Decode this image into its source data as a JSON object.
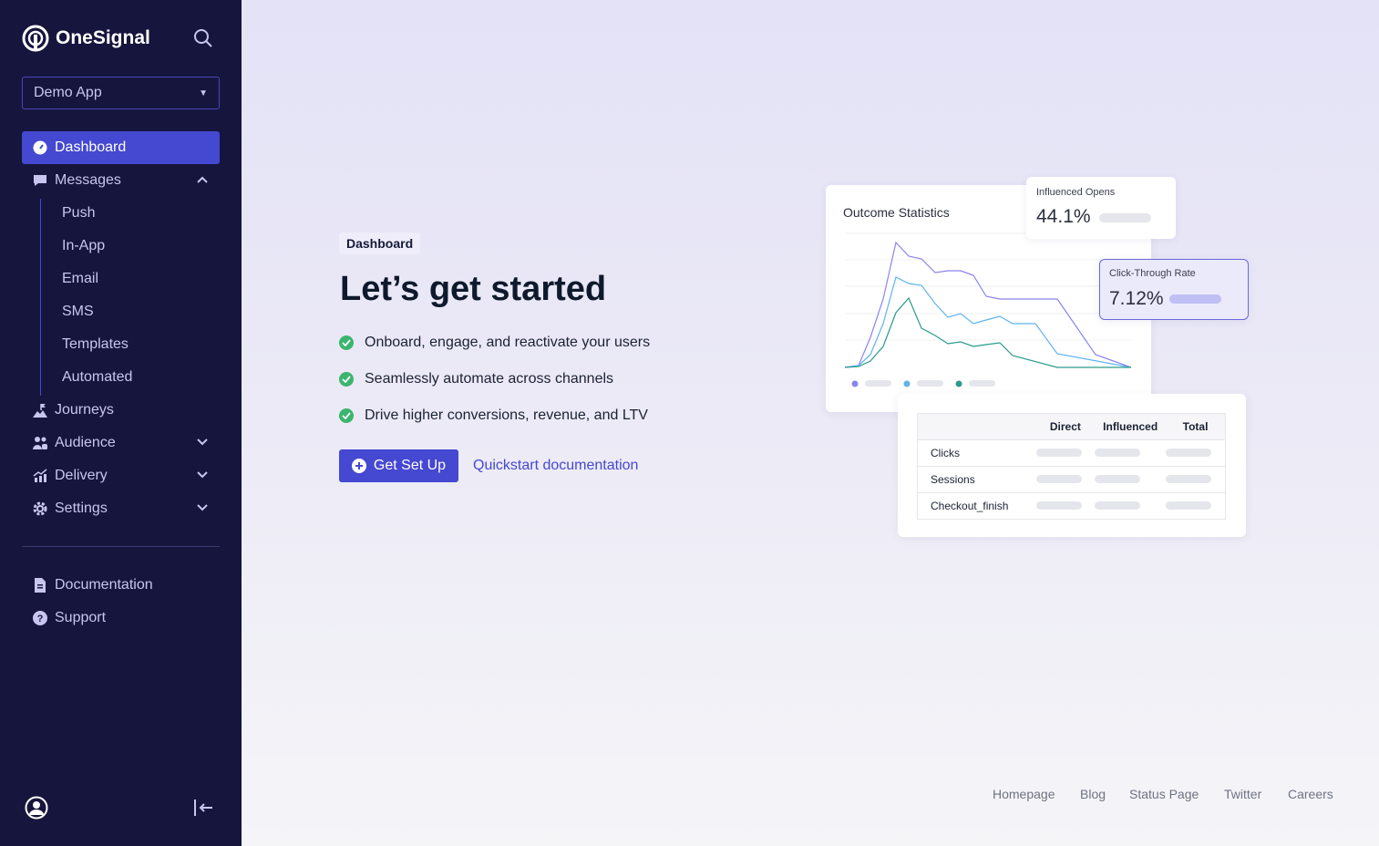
{
  "sidebar": {
    "brand": "OneSignal",
    "app_selector": "Demo App",
    "nav": [
      {
        "label": "Dashboard",
        "icon": "dashboard-gauge-icon",
        "active": true
      },
      {
        "label": "Messages",
        "icon": "message-icon",
        "expanded": true
      },
      {
        "label": "Journeys",
        "icon": "journey-flag-icon"
      },
      {
        "label": "Audience",
        "icon": "users-icon"
      },
      {
        "label": "Delivery",
        "icon": "chart-icon"
      },
      {
        "label": "Settings",
        "icon": "gear-icon"
      }
    ],
    "messages_sub": [
      "Push",
      "In-App",
      "Email",
      "SMS",
      "Templates",
      "Automated"
    ],
    "bottom": [
      {
        "label": "Documentation",
        "icon": "document-icon"
      },
      {
        "label": "Support",
        "icon": "help-icon"
      }
    ]
  },
  "main": {
    "badge": "Dashboard",
    "title": "Let’s get started",
    "features": [
      "Onboard, engage, and reactivate your users",
      "Seamlessly automate across channels",
      "Drive higher conversions, revenue, and LTV"
    ],
    "cta": "Get Set Up",
    "link": "Quickstart documentation"
  },
  "illustration": {
    "card_title": "Outcome Statistics",
    "opens": {
      "label": "Influenced Opens",
      "value": "44.1%"
    },
    "ctr": {
      "label": "Click-Through Rate",
      "value": "7.12%"
    },
    "table": {
      "headers": [
        "Direct",
        "Influenced",
        "Total"
      ],
      "rows": [
        "Clicks",
        "Sessions",
        "Checkout_finish"
      ]
    },
    "colors": {
      "purple": "#8b84ee",
      "blue": "#5fb3f0",
      "green": "#2a9a8c"
    }
  },
  "footer": [
    "Homepage",
    "Blog",
    "Status Page",
    "Twitter",
    "Careers"
  ],
  "colors": {
    "sidebar": "#16153d",
    "accent": "#4548d0",
    "check": "#3bb56e"
  }
}
